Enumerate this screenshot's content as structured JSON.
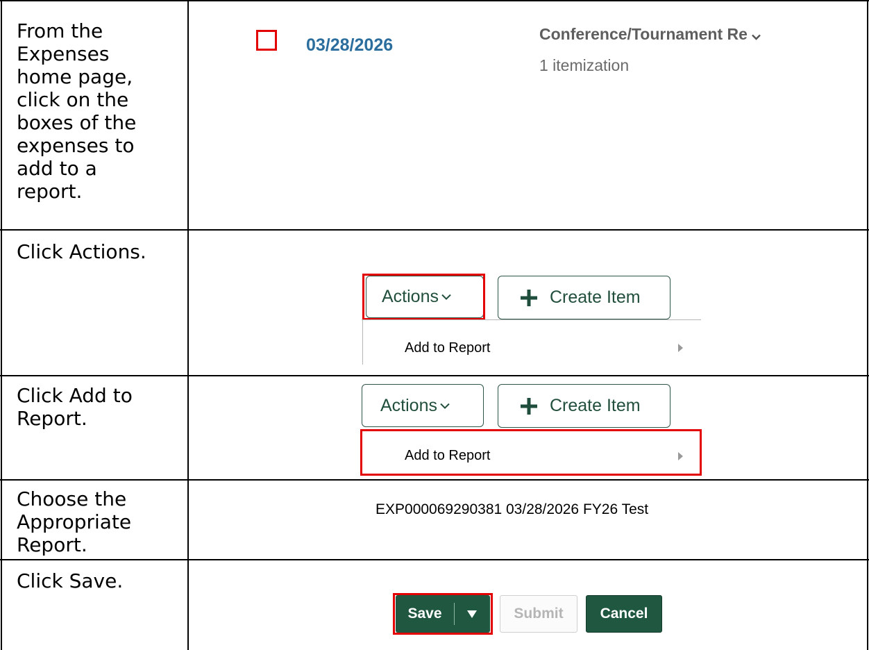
{
  "steps": [
    {
      "instruction": "From the\nExpenses\nhome page,\nclick on the\nboxes of the\nexpenses to\nadd to a\nreport."
    },
    {
      "instruction": "Click Actions."
    },
    {
      "instruction": "Click Add to\nReport."
    },
    {
      "instruction": "Choose the\nAppropriate\nReport."
    },
    {
      "instruction": "Click Save."
    }
  ],
  "expense": {
    "date": "03/28/2026",
    "type": "Conference/Tournament Re",
    "itemization": "1 itemization"
  },
  "toolbar": {
    "actions_label": "Actions",
    "create_item_label": "Create Item",
    "add_to_report_label": "Add to Report"
  },
  "report": {
    "name": "EXP000069290381 03/28/2026 FY26 Test"
  },
  "footer_buttons": {
    "save_label": "Save",
    "submit_label": "Submit",
    "cancel_label": "Cancel"
  },
  "colors": {
    "highlight": "#e30000",
    "brand_green": "#1f5740",
    "link_blue": "#2b6e9e"
  },
  "icons": [
    "chevron-down-icon",
    "plus-icon",
    "submenu-arrow-icon",
    "dropdown-caret-icon"
  ]
}
